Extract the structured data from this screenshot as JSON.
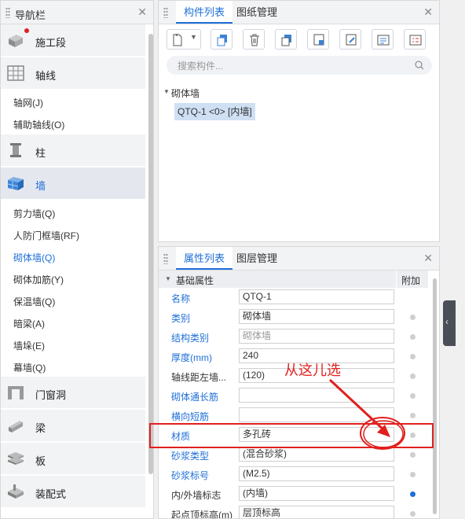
{
  "nav": {
    "title": "导航栏",
    "items": [
      {
        "label": "施工段",
        "icon": "construction-segment-icon"
      },
      {
        "label": "轴线",
        "icon": "grid-axis-icon"
      },
      {
        "label": "轴网(J)"
      },
      {
        "label": "辅助轴线(O)"
      },
      {
        "label": "柱",
        "icon": "column-icon"
      },
      {
        "label": "墙",
        "icon": "wall-icon"
      },
      {
        "label": "剪力墙(Q)"
      },
      {
        "label": "人防门框墙(RF)"
      },
      {
        "label": "砌体墙(Q)"
      },
      {
        "label": "砌体加筋(Y)"
      },
      {
        "label": "保温墙(Q)"
      },
      {
        "label": "暗梁(A)"
      },
      {
        "label": "墙垛(E)"
      },
      {
        "label": "幕墙(Q)"
      },
      {
        "label": "门窗洞",
        "icon": "door-window-icon"
      },
      {
        "label": "梁",
        "icon": "beam-icon"
      },
      {
        "label": "板",
        "icon": "slab-icon"
      },
      {
        "label": "装配式",
        "icon": "prefab-icon"
      }
    ]
  },
  "component_panel": {
    "tabs": [
      "构件列表",
      "图纸管理"
    ],
    "search_placeholder": "搜索构件...",
    "tree": {
      "group": "砌体墙",
      "item": "QTQ-1 <0> [内墙]"
    }
  },
  "property_panel": {
    "tabs": [
      "属性列表",
      "图层管理"
    ],
    "section": "基础属性",
    "extra_header": "附加",
    "rows": [
      {
        "name": "名称",
        "value": "QTQ-1",
        "link": true,
        "dot": false
      },
      {
        "name": "类别",
        "value": "砌体墙",
        "link": true,
        "dot": true
      },
      {
        "name": "结构类别",
        "value": "砌体墙",
        "link": true,
        "dot": true,
        "gray": true
      },
      {
        "name": "厚度(mm)",
        "value": "240",
        "link": true,
        "dot": true
      },
      {
        "name": "轴线距左墙...",
        "value": "(120)",
        "link": false,
        "dot": true
      },
      {
        "name": "砌体通长筋",
        "value": "",
        "link": true,
        "dot": true
      },
      {
        "name": "横向短筋",
        "value": "",
        "link": true,
        "dot": true
      },
      {
        "name": "材质",
        "value": "多孔砖",
        "link": true,
        "dot": true
      },
      {
        "name": "砂浆类型",
        "value": "(混合砂浆)",
        "link": true,
        "dot": true
      },
      {
        "name": "砂浆标号",
        "value": "(M2.5)",
        "link": true,
        "dot": true
      },
      {
        "name": "内/外墙标志",
        "value": "(内墙)",
        "link": false,
        "dot": true,
        "dot_on": true
      },
      {
        "name": "起点顶标高(m)",
        "value": "层顶标高",
        "link": false,
        "dot": true
      }
    ]
  },
  "annotation": {
    "text": "从这儿选",
    "color": "#e0201e"
  }
}
